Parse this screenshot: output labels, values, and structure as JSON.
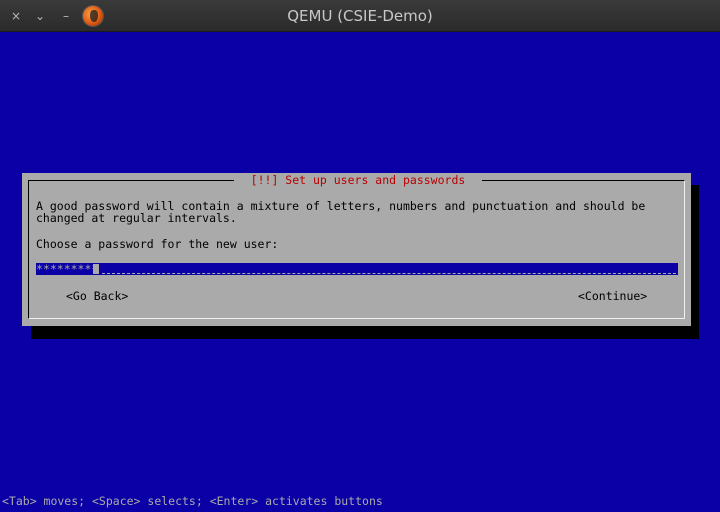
{
  "window": {
    "title": "QEMU (CSIE-Demo)",
    "close_glyph": "×",
    "minimize_glyph": "⌄",
    "maximize_glyph": "–"
  },
  "dialog": {
    "title": "[!!] Set up users and passwords",
    "help_line1": "A good password will contain a mixture of letters, numbers and punctuation and should be",
    "help_line2": "changed at regular intervals.",
    "prompt": "Choose a password for the new user:",
    "password_value": "*********",
    "go_back_label": "<Go Back>",
    "continue_label": "<Continue>"
  },
  "status_bar": {
    "text": "<Tab> moves; <Space> selects; <Enter> activates buttons"
  },
  "colors": {
    "console_blue": "#0a00a5",
    "dialog_gray": "#aaaaaa",
    "title_red": "#b80000"
  }
}
